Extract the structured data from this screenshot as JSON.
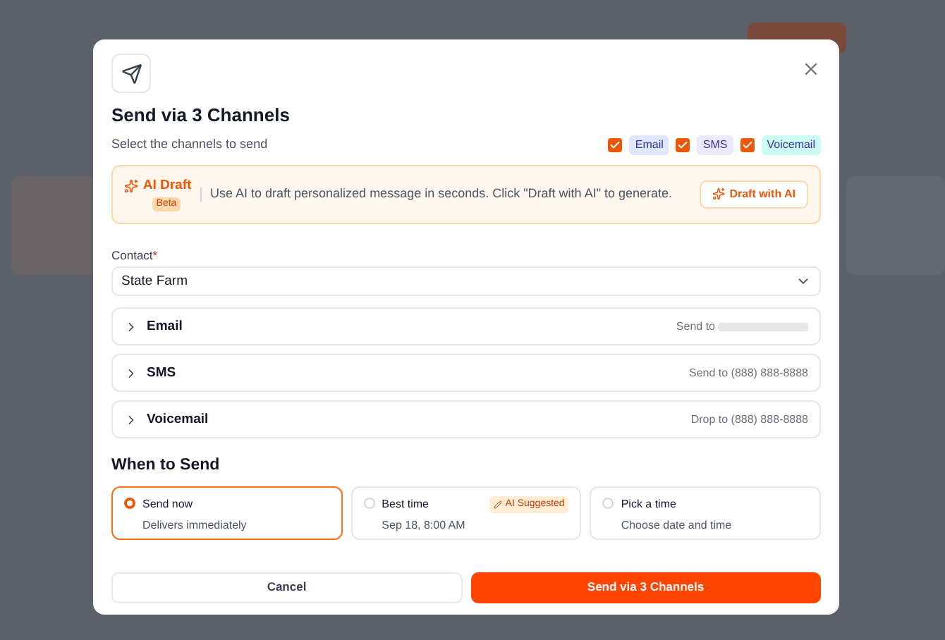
{
  "dialog": {
    "title": "Send via 3 Channels",
    "subtitle": "Select the channels to send",
    "channels": [
      {
        "label": "Email",
        "checked": true,
        "color": "#e0e7ff"
      },
      {
        "label": "SMS",
        "checked": true,
        "color": "#ede9fe"
      },
      {
        "label": "Voicemail",
        "checked": true,
        "color": "#ccfbf1"
      }
    ],
    "ai_draft": {
      "title": "AI Draft",
      "badge": "Beta",
      "text": "Use AI to draft personalized message in seconds. Click \"Draft with AI\" to generate.",
      "button": "Draft with AI"
    },
    "contact": {
      "label": "Contact",
      "required": "*",
      "value": "State Farm"
    },
    "sections": [
      {
        "title": "Email",
        "detail": "Send to",
        "redacted": true,
        "expanded": false
      },
      {
        "title": "SMS",
        "detail": "Send to (888) 888-8888",
        "redacted": false,
        "expanded": false
      },
      {
        "title": "Voicemail",
        "detail": "Drop to (888) 888-8888",
        "redacted": false,
        "expanded": false
      }
    ],
    "when": {
      "title": "When to Send",
      "options": [
        {
          "title": "Send now",
          "detail": "Delivers immediately",
          "selected": true
        },
        {
          "title": "Best time",
          "detail": "Sep 18, 8:00 AM",
          "badge": "AI Suggested",
          "selected": false
        },
        {
          "title": "Pick a time",
          "detail": "Choose date and time",
          "selected": false
        }
      ]
    },
    "buttons": {
      "cancel": "Cancel",
      "submit": "Send via 3 Channels"
    }
  }
}
